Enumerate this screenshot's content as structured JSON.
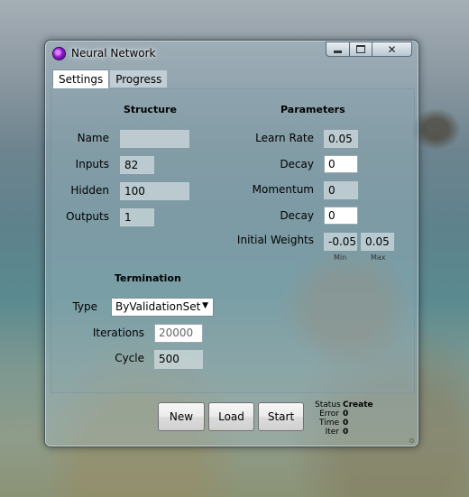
{
  "window": {
    "title": "Neural Network"
  },
  "tabs": [
    {
      "label": "Settings",
      "active": true
    },
    {
      "label": "Progress",
      "active": false
    }
  ],
  "structure": {
    "heading": "Structure",
    "name_label": "Name",
    "name_value": "",
    "inputs_label": "Inputs",
    "inputs_value": "82",
    "hidden_label": "Hidden",
    "hidden_value": "100",
    "outputs_label": "Outputs",
    "outputs_value": "1"
  },
  "parameters": {
    "heading": "Parameters",
    "learn_rate_label": "Learn Rate",
    "learn_rate_value": "0.05",
    "decay1_label": "Decay",
    "decay1_value": "0",
    "momentum_label": "Momentum",
    "momentum_value": "0",
    "decay2_label": "Decay",
    "decay2_value": "0",
    "initial_weights_label": "Initial Weights",
    "weight_min_value": "-0.05",
    "weight_max_value": "0.05",
    "min_caption": "Min",
    "max_caption": "Max"
  },
  "termination": {
    "heading": "Termination",
    "type_label": "Type",
    "type_value": "ByValidationSet",
    "iterations_label": "Iterations",
    "iterations_placeholder": "20000",
    "cycle_label": "Cycle",
    "cycle_value": "500"
  },
  "buttons": {
    "new": "New",
    "load": "Load",
    "start": "Start"
  },
  "status": [
    {
      "key": "Status",
      "value": "Create"
    },
    {
      "key": "Error",
      "value": "0"
    },
    {
      "key": "Time",
      "value": "0"
    },
    {
      "key": "Iter",
      "value": "0"
    }
  ],
  "icons": {
    "app": "neural-network-app-icon",
    "minimize": "minimize-icon",
    "maximize": "maximize-icon",
    "close": "close-icon",
    "dropdown": "chevron-down-icon",
    "resize": "resize-grip-icon"
  }
}
